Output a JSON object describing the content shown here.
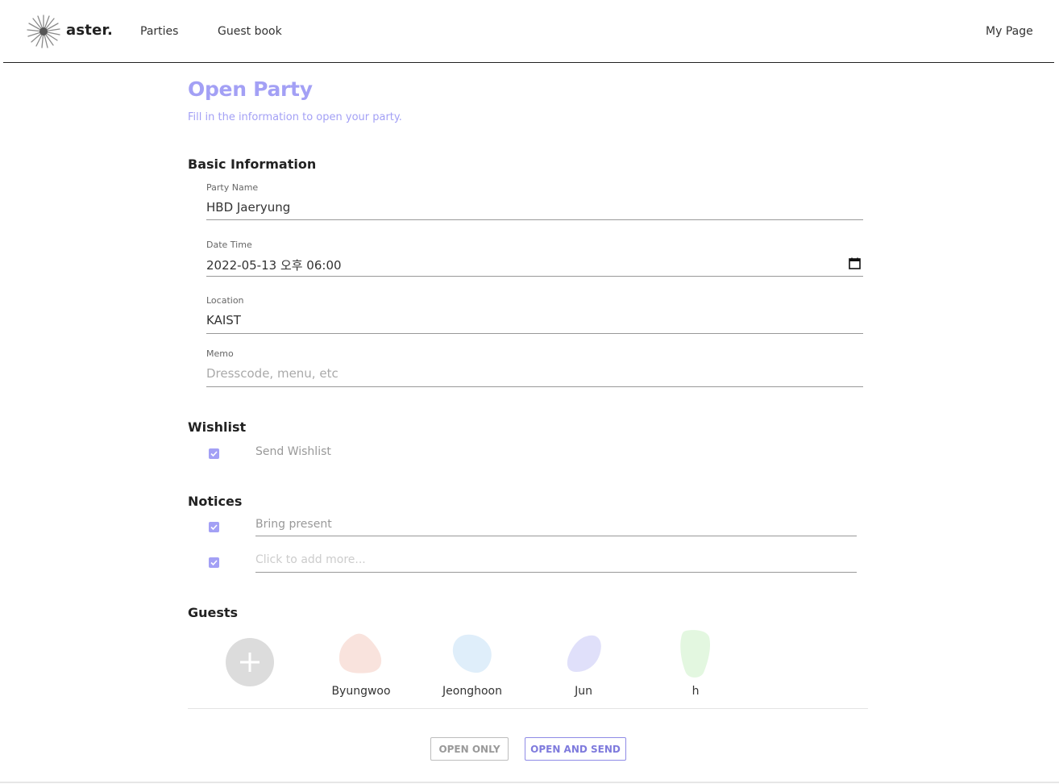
{
  "header": {
    "logo_text": "aster.",
    "nav": {
      "parties": "Parties",
      "guest_book": "Guest book",
      "my_page": "My Page"
    }
  },
  "page": {
    "title": "Open Party",
    "subtitle": "Fill in the information to open your party."
  },
  "basic_information": {
    "title": "Basic Information",
    "party_name": {
      "label": "Party Name",
      "value": "HBD Jaeryung"
    },
    "date_time": {
      "label": "Date Time",
      "value": "2022-05-13 오후 06:00"
    },
    "location": {
      "label": "Location",
      "value": "KAIST"
    },
    "memo": {
      "label": "Memo",
      "placeholder": "Dresscode, menu, etc"
    }
  },
  "wishlist": {
    "title": "Wishlist",
    "send_label": "Send Wishlist",
    "checked": true
  },
  "notices": {
    "title": "Notices",
    "items": [
      {
        "text": "Bring present",
        "checked": true
      },
      {
        "placeholder": "Click to add more...",
        "checked": true
      }
    ]
  },
  "guests": {
    "title": "Guests",
    "list": [
      {
        "name": "Byungwoo",
        "color": "#f9e3dd"
      },
      {
        "name": "Jeonghoon",
        "color": "#dfeefa"
      },
      {
        "name": "Jun",
        "color": "#e0e0fa"
      },
      {
        "name": "h",
        "color": "#e3f7e0"
      }
    ]
  },
  "actions": {
    "open_only": "OPEN ONLY",
    "open_and_send": "OPEN AND SEND"
  },
  "colors": {
    "accent": "#a3a0f5",
    "add_guest": "#dcdcdc"
  }
}
